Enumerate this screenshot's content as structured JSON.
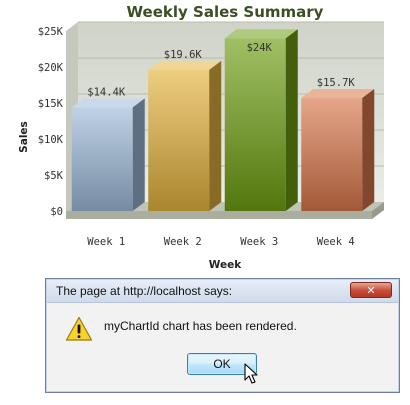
{
  "chart_data": {
    "type": "bar",
    "title": "Weekly Sales Summary",
    "xlabel": "Week",
    "ylabel": "Sales",
    "categories": [
      "Week 1",
      "Week 2",
      "Week 3",
      "Week 4"
    ],
    "values": [
      14400,
      19600,
      24000,
      15700
    ],
    "value_labels": [
      "$14.4K",
      "$19.6K",
      "$24K",
      "$15.7K"
    ],
    "y_ticks": [
      0,
      5000,
      10000,
      15000,
      20000,
      25000
    ],
    "y_tick_labels": [
      "$0",
      "$5K",
      "$10K",
      "$15K",
      "$20K",
      "$25K"
    ],
    "ylim": [
      0,
      25000
    ],
    "grid": true,
    "style": "3d-column",
    "colors": [
      "#9db9d8",
      "#e3b23c",
      "#6f9e12",
      "#d9764a"
    ]
  },
  "dialog": {
    "title": "The page at http://localhost says:",
    "close_glyph": "✕",
    "message": "myChartId chart has been rendered.",
    "ok_label": "OK",
    "icon": "warning-icon"
  }
}
